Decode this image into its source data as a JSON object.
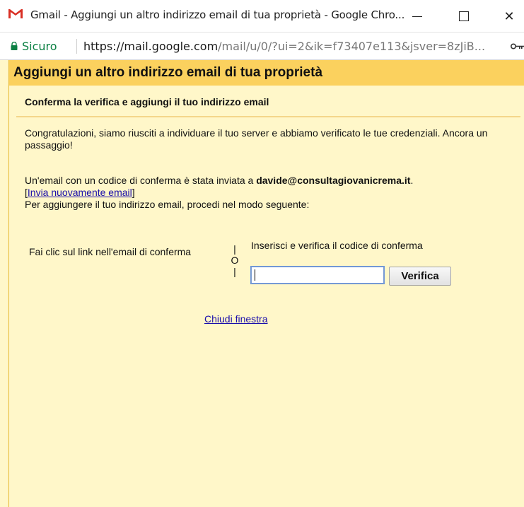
{
  "window": {
    "title": "Gmail - Aggiungi un altro indirizzo email di tua proprietà - Google Chro...",
    "minimize_icon": "minimize-icon",
    "maximize_icon": "maximize-icon",
    "close_glyph": "✕"
  },
  "addressbar": {
    "secure_label": "Sicuro",
    "url_host": "https://mail.google.com",
    "url_rest": "/mail/u/0/?ui=2&ik=f73407e113&jsver=8zJiB..."
  },
  "dialog": {
    "title": "Aggiungi un altro indirizzo email di tua proprietà",
    "subtitle": "Conferma la verifica e aggiungi il tuo indirizzo email",
    "congrats": "Congratulazioni, siamo riusciti a individuare il tuo server e abbiamo verificato le tue credenziali. Ancora un passaggio!",
    "sent_prefix": "Un'email con un codice di conferma è stata inviata a ",
    "email": "davide@consultagiovanicrema.it",
    "sent_suffix": ".",
    "resend_open": "[",
    "resend_link": "Invia nuovamente email",
    "resend_close": "]",
    "instruction": "Per aggiungere il tuo indirizzo email, procedi nel modo seguente:",
    "option_left": "Fai clic sul link nell'email di conferma",
    "or_bar_top": "|",
    "or_text": "O",
    "or_bar_bottom": "|",
    "option_right": "Inserisci e verifica il codice di conferma",
    "code_value": "",
    "verify_label": "Verifica",
    "close_link": "Chiudi finestra"
  },
  "colors": {
    "header_bg": "#fbd15e",
    "content_bg": "#fff7c9",
    "secure_green": "#0b8043",
    "link_blue": "#1a0dab"
  }
}
